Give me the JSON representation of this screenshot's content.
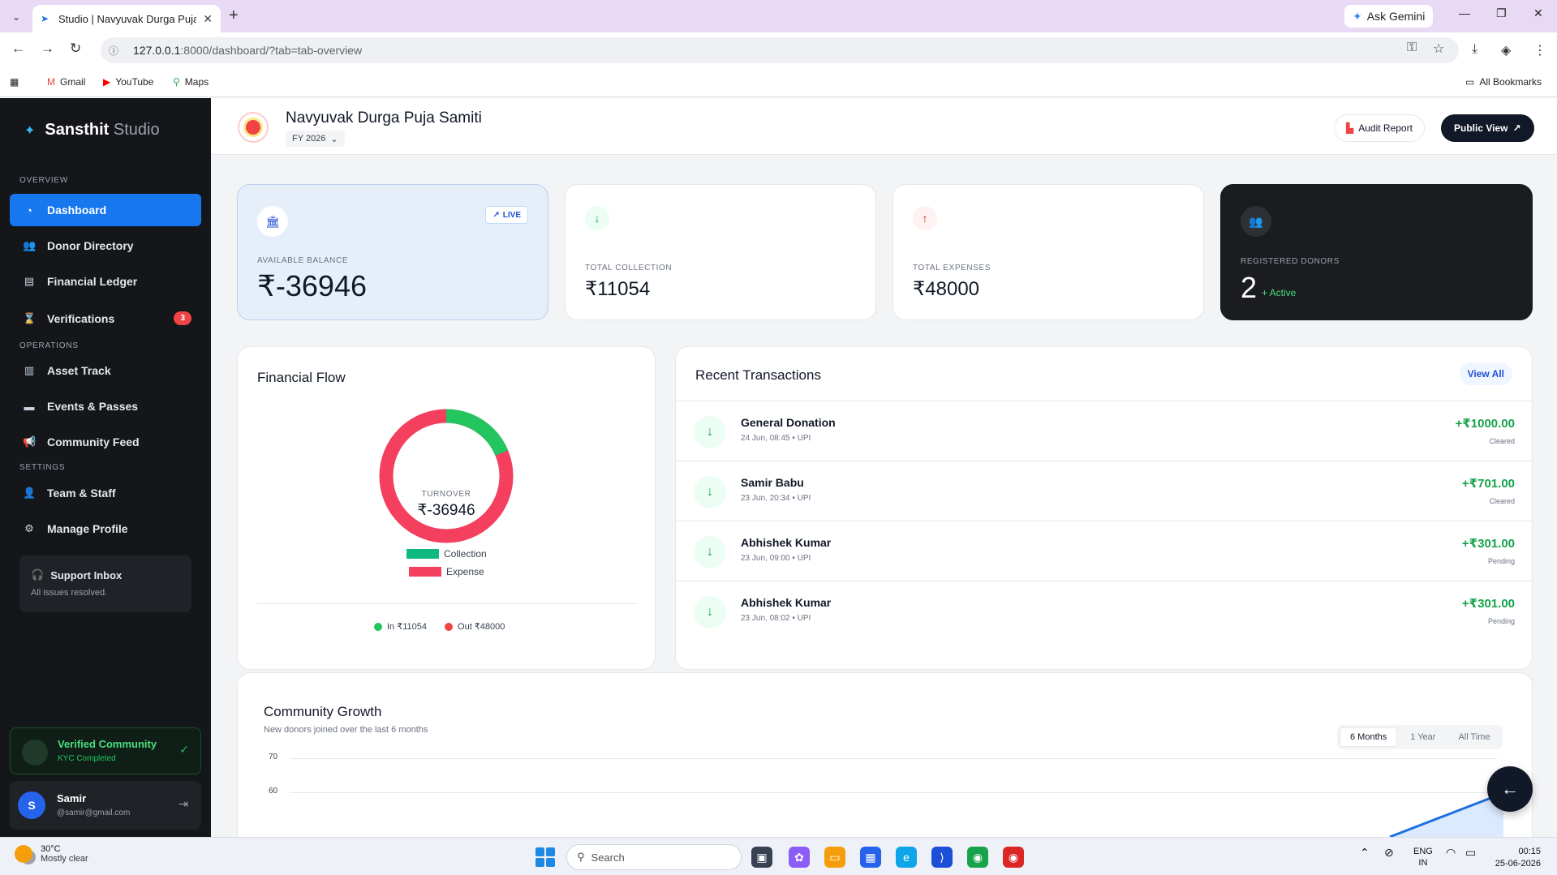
{
  "browser": {
    "tab_title": "Studio | Navyuvak Durga Puja S",
    "ask_gemini": "Ask Gemini",
    "url_host": "127.0.0.1",
    "url_path": ":8000/dashboard/?tab=tab-overview",
    "bookmarks": [
      "Gmail",
      "YouTube",
      "Maps"
    ],
    "all_bookmarks": "All Bookmarks"
  },
  "sidebar": {
    "brand_main": "Sansthit",
    "brand_sub": "Studio",
    "sections": {
      "overview": "OVERVIEW",
      "operations": "OPERATIONS",
      "settings": "SETTINGS"
    },
    "items": [
      {
        "label": "Dashboard",
        "icon": "pie-chart-icon"
      },
      {
        "label": "Donor Directory",
        "icon": "users-icon"
      },
      {
        "label": "Financial Ledger",
        "icon": "file-icon"
      },
      {
        "label": "Verifications",
        "icon": "hourglass-icon",
        "badge": "3"
      },
      {
        "label": "Asset Track",
        "icon": "warehouse-icon"
      },
      {
        "label": "Events & Passes",
        "icon": "ticket-icon"
      },
      {
        "label": "Community Feed",
        "icon": "megaphone-icon"
      },
      {
        "label": "Team & Staff",
        "icon": "user-tie-icon"
      },
      {
        "label": "Manage Profile",
        "icon": "gear-icon"
      }
    ],
    "support_title": "Support Inbox",
    "support_status": "All issues resolved.",
    "kyc_title": "Verified Community",
    "kyc_sub": "KYC Completed",
    "user_initial": "S",
    "user_name": "Samir",
    "user_email": "@samir@gmail.com"
  },
  "header": {
    "org_name": "Navyuvak Durga Puja Samiti",
    "fiscal_year": "FY 2026",
    "audit_button": "Audit Report",
    "public_button": "Public View"
  },
  "stats": {
    "balance_label": "AVAILABLE BALANCE",
    "balance_value": "₹-36946",
    "live_label": "LIVE",
    "collection_label": "TOTAL COLLECTION",
    "collection_value": "₹11054",
    "expenses_label": "TOTAL EXPENSES",
    "expenses_value": "₹48000",
    "donors_label": "REGISTERED DONORS",
    "donors_value": "2",
    "donors_status": "+ Active"
  },
  "financial_flow": {
    "title": "Financial Flow",
    "center_label": "TURNOVER",
    "center_value": "₹-36946",
    "legend_collection": "Collection",
    "legend_expense": "Expense",
    "in_label": "In ₹11054",
    "out_label": "Out ₹48000",
    "collection": 11054,
    "expense": 48000,
    "colors": {
      "collection": "#22c55e",
      "expense": "#f43f5e"
    }
  },
  "transactions": {
    "title": "Recent Transactions",
    "view_all": "View All",
    "rows": [
      {
        "name": "General Donation",
        "meta": "24 Jun, 08:45 • UPI",
        "amount": "+₹1000.00",
        "status": "Cleared"
      },
      {
        "name": "Samir Babu",
        "meta": "23 Jun, 20:34 • UPI",
        "amount": "+₹701.00",
        "status": "Cleared"
      },
      {
        "name": "Abhishek Kumar",
        "meta": "23 Jun, 09:00 • UPI",
        "amount": "+₹301.00",
        "status": "Pending"
      },
      {
        "name": "Abhishek Kumar",
        "meta": "23 Jun, 08:02 • UPI",
        "amount": "+₹301.00",
        "status": "Pending"
      }
    ]
  },
  "growth": {
    "title": "Community Growth",
    "subtitle": "New donors joined over the last 6 months",
    "ranges": [
      "6 Months",
      "1 Year",
      "All Time"
    ],
    "y_ticks": [
      "70",
      "60"
    ]
  },
  "taskbar": {
    "temp": "30°C",
    "weather": "Mostly clear",
    "search": "Search",
    "lang1": "ENG",
    "lang2": "IN",
    "time": "00:15",
    "date": "25-06-2026"
  }
}
